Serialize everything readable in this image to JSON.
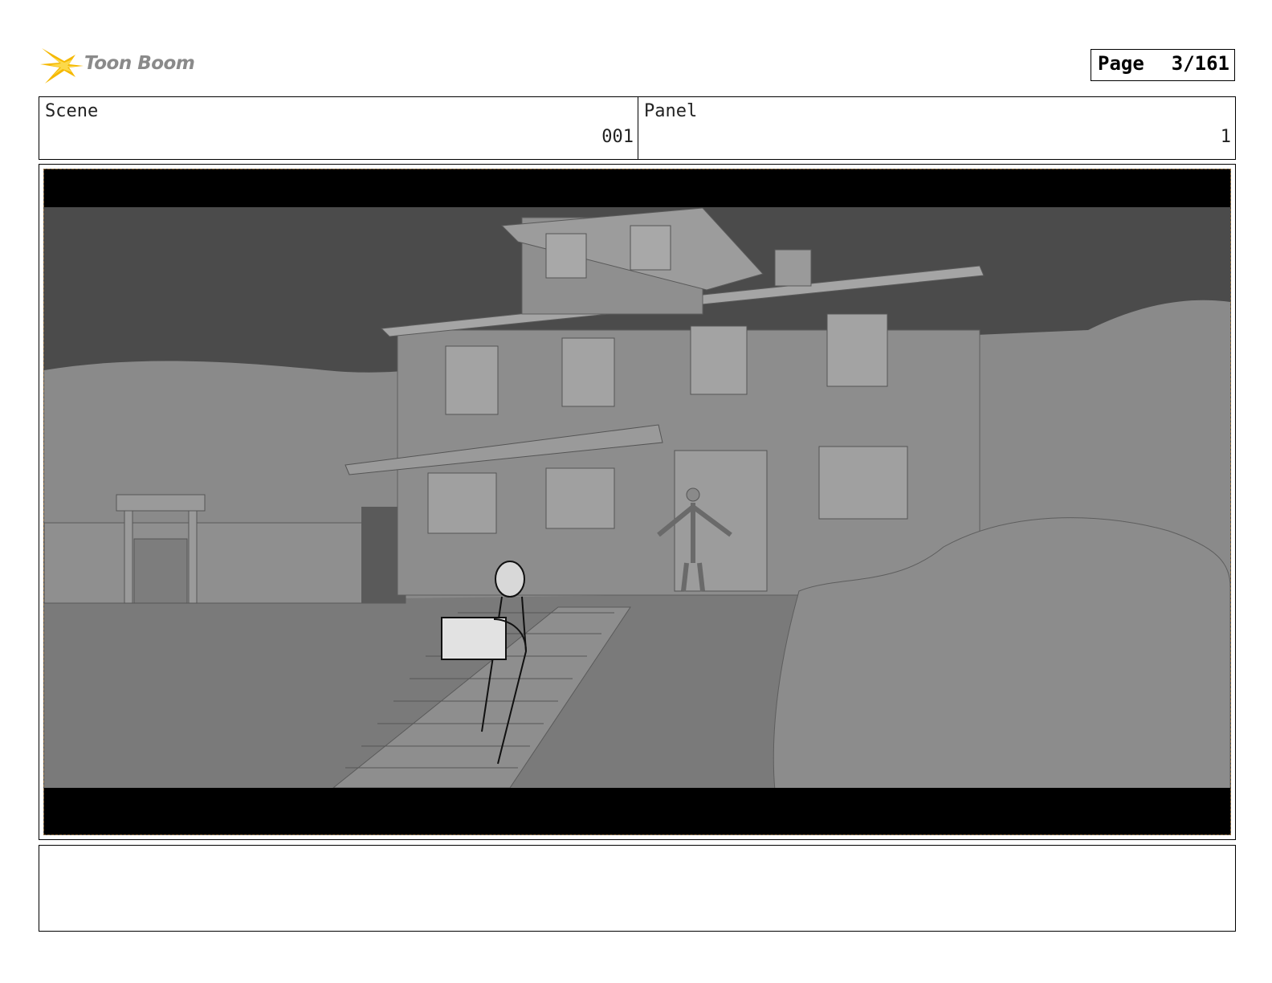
{
  "logo": {
    "text": "Toon Boom",
    "accent_color": "#f5b800"
  },
  "page": {
    "label": "Page",
    "value": "3/161"
  },
  "header": {
    "scene": {
      "label": "Scene",
      "value": "001"
    },
    "panel": {
      "label": "Panel",
      "value": "1"
    }
  },
  "panel_image": {
    "description_icon": "storyboard-frame-icon"
  },
  "notes": {
    "text": ""
  }
}
